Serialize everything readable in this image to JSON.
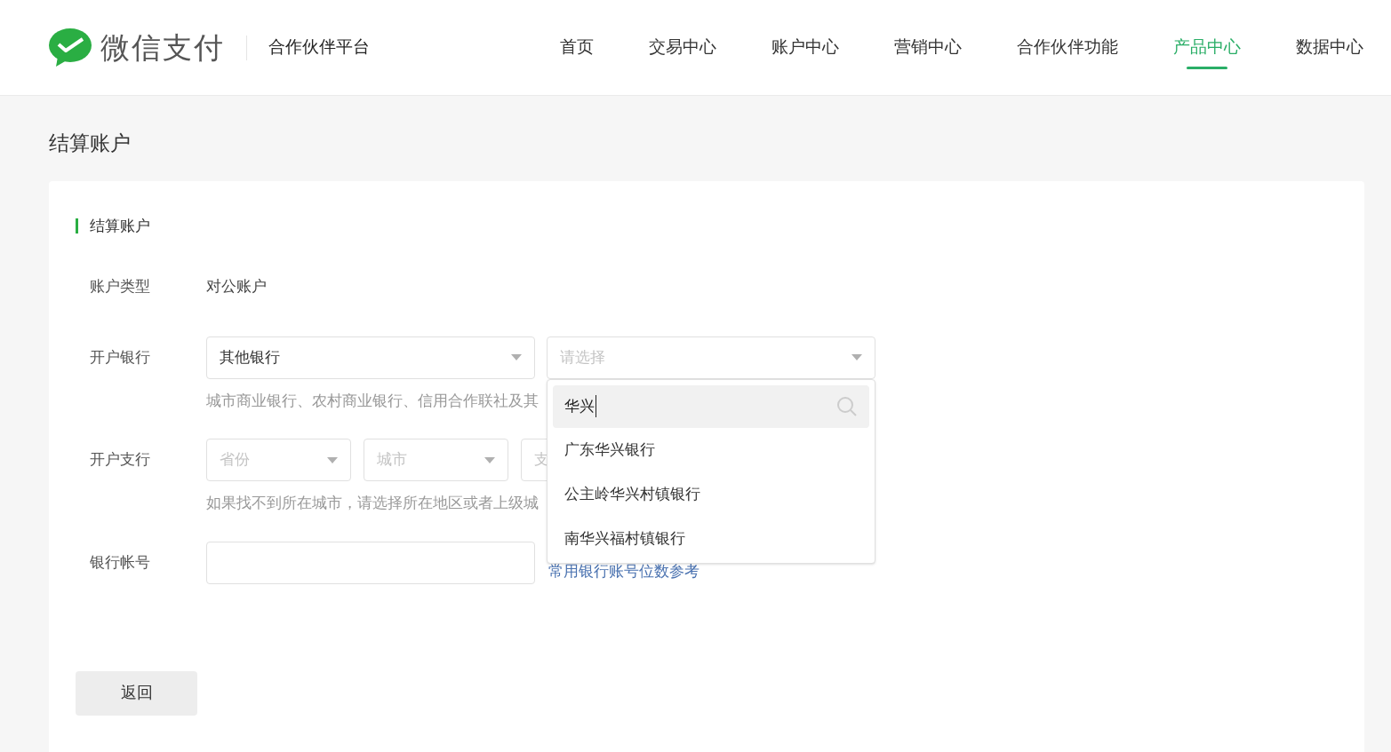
{
  "header": {
    "brand": "微信支付",
    "platform": "合作伙伴平台",
    "nav": [
      {
        "label": "首页",
        "selected": false
      },
      {
        "label": "交易中心",
        "selected": false
      },
      {
        "label": "账户中心",
        "selected": false
      },
      {
        "label": "营销中心",
        "selected": false
      },
      {
        "label": "合作伙伴功能",
        "selected": false
      },
      {
        "label": "产品中心",
        "selected": true
      },
      {
        "label": "数据中心",
        "selected": false
      }
    ]
  },
  "page_title": "结算账户",
  "section_title": "结算账户",
  "form": {
    "account_type": {
      "label": "账户类型",
      "value": "对公账户"
    },
    "bank": {
      "label": "开户银行",
      "selects": [
        {
          "value": "其他银行"
        },
        {
          "placeholder": "请选择"
        }
      ],
      "hint": "城市商业银行、农村商业银行、信用合作联社及其"
    },
    "branch": {
      "label": "开户支行",
      "selects": [
        {
          "placeholder": "省份"
        },
        {
          "placeholder": "城市"
        },
        {
          "placeholder": "支"
        }
      ],
      "hint": "如果找不到所在城市，请选择所在地区或者上级城"
    },
    "account_number": {
      "label": "银行帐号",
      "link": "常用银行账号位数参考"
    }
  },
  "dropdown": {
    "search_value": "华兴",
    "options": [
      "广东华兴银行",
      "公主岭华兴村镇银行",
      "南华兴福村镇银行"
    ]
  },
  "back_button": "返回"
}
